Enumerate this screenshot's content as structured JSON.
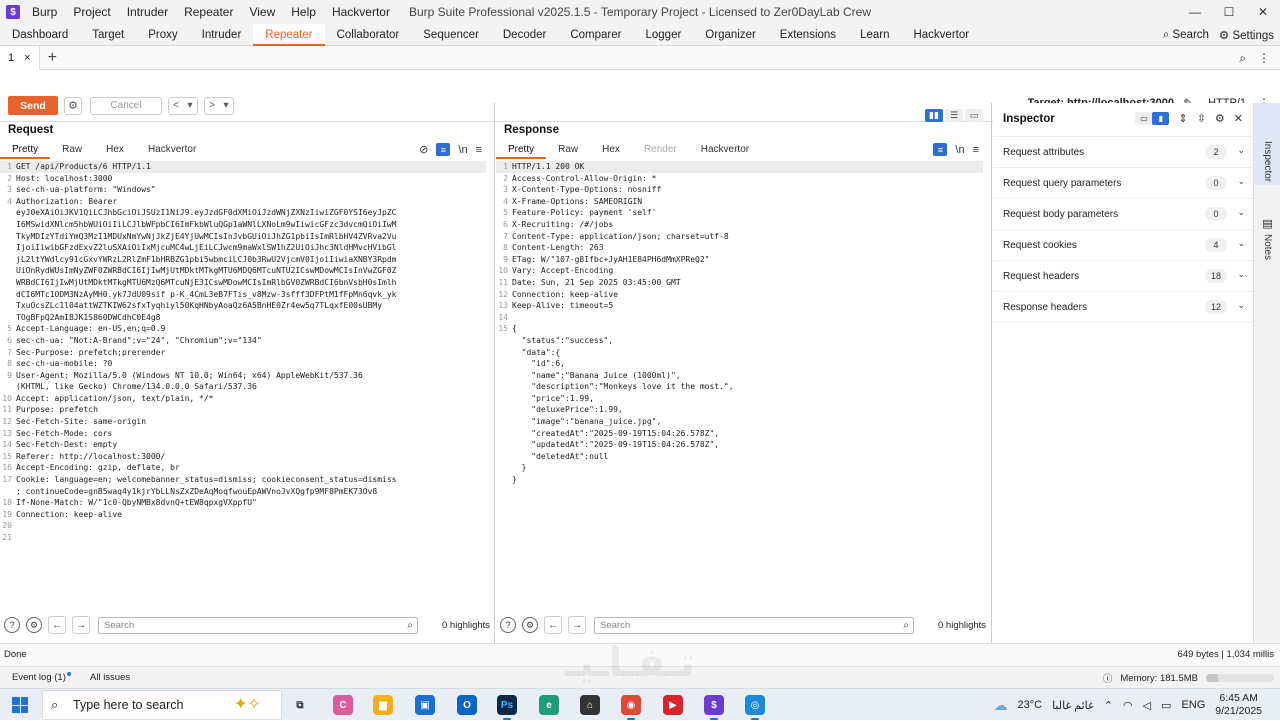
{
  "app": {
    "icon_letter": "$",
    "menu": [
      "Burp",
      "Project",
      "Intruder",
      "Repeater",
      "View",
      "Help",
      "Hackvertor"
    ],
    "title": "Burp Suite Professional v2025.1.5 - Temporary Project - Licensed to Zer0DayLab Crew",
    "window_controls": [
      "—",
      "☐",
      "✕"
    ]
  },
  "main_tabs": {
    "items": [
      "Dashboard",
      "Target",
      "Proxy",
      "Intruder",
      "Repeater",
      "Collaborator",
      "Sequencer",
      "Decoder",
      "Comparer",
      "Logger",
      "Organizer",
      "Extensions",
      "Learn",
      "Hackvertor"
    ],
    "active": "Repeater",
    "search_label": "Search",
    "settings_label": "Settings"
  },
  "repeater_tabs": {
    "tab_label": "1",
    "close": "×",
    "add": "+"
  },
  "toolbar": {
    "send_label": "Send",
    "cancel_label": "Cancel",
    "target_label": "Target: http://localhost:3000",
    "http_label": "HTTP/1"
  },
  "request": {
    "title": "Request",
    "view_tabs": [
      "Pretty",
      "Raw",
      "Hex",
      "Hackvertor"
    ],
    "active_view": "Pretty",
    "lines": [
      "GET /api/Products/6 HTTP/1.1",
      "Host: localhost:3000",
      "sec-ch-ua-platform: \"Windows\"",
      "Authorization: Bearer",
      "eyJ0eXAiOiJKV1QiLCJhbGciOiJSUzI1NiJ9.eyJzdGF0dXMiOiJzdWNjZXNzIiwiZGF0YSI6eyJpZC",
      "I6MSwidXNlcm5hbWUiOiIiLCJlbWFpbCI6ImFkbWluQGp1aWNlLXNoLm9wIiwicGFzc3dvcmQiOiIwM",
      "TkyMDIzYTdiYmQ3MzI1MDUxNmYwNjJkZjE4YjUwMCIsInJvbGUiOiJhZG1pbiIsImRlbHV4ZVRva2Vu",
      "IjoiIiwibGFzdExvZ2luSXAiOiIxMjcuMC4wLjEiLCJwcm9maWxlSW1hZ2UiOiJhc3NldHMvcHVibGl",
      "jL2ltYWdlcy91cGxvYWRzL2RlZmF1bHRBZG1pbi5wbmciLCJ0b3RwU2VjcmV0IjoiIiwiaXNBY3Rpdm",
      "UiOnRydWUsImNyZWF0ZWRBdCI6IjIwMjUtMDktMTkgMTU6MDQ6MTcuNTU2ICswMDowMCIsInVwZGF0Z",
      "WRBdCI6IjIwMjUtMDktMTkgMTU6MzQ6MTcuNjE3ICswMDowMCIsImRlbGV0ZWRBdCI6bnVsbH0sImlh",
      "dCI6MTc1ODM3NzAyMH0.yk7JdU09sif p-K_4CmL3eB7FTis_v8Mzw-3sfff3DFPtM1fFpMn6qvk_yk",
      "TxuOcsZLc1l04attWZTKIW62sfxTyqhiyl50KqHNbyAoaQz6A5BnHE0Zr4ew5q7TLqxfE00sUBMy",
      "TOgBFpQ2AmIBJK1S860DWCdhC0E4g8",
      "Accept-Language: en-US,en;q=0.9",
      "sec-ch-ua: \"Not:A-Brand\";v=\"24\", \"Chromium\";v=\"134\"",
      "Sec-Purpose: prefetch;prerender",
      "sec-ch-ua-mobile: ?0",
      "User-Agent: Mozilla/5.0 (Windows NT 10.0; Win64; x64) AppleWebKit/537.36",
      "(KHTML, like Gecko) Chrome/134.0.0.0 Safari/537.36",
      "Accept: application/json, text/plain, */*",
      "Purpose: prefetch",
      "Sec-Fetch-Site: same-origin",
      "Sec-Fetch-Mode: cors",
      "Sec-Fetch-Dest: empty",
      "Referer: http://localhost:3000/",
      "Accept-Encoding: gzip, deflate, br",
      "Cookie: language=en; welcomebanner_status=dismiss; cookieconsent_status=dismiss",
      "; continueCode=gnB5waq4y1kjrYbLLNsZxZDeAqMoqfwouEpAWVnoJvXQgfp9MF8PmEK73Ov8",
      "If-None-Match: W/\"1c0-QbyNMBx8dvnQ+tEW8qpxgVXppfU\"",
      "Connection: keep-alive",
      "",
      ""
    ],
    "line_numbers": [
      "1",
      "2",
      "3",
      "4",
      "",
      "",
      "",
      "",
      "",
      "",
      "",
      "",
      "",
      "",
      "5",
      "6",
      "7",
      "8",
      "9",
      "",
      "10",
      "11",
      "12",
      "13",
      "14",
      "15",
      "16",
      "17",
      "",
      "18",
      "19",
      "20",
      "21"
    ]
  },
  "response": {
    "title": "Response",
    "view_tabs": [
      "Pretty",
      "Raw",
      "Hex",
      "Render",
      "Hackvertor"
    ],
    "active_view": "Pretty",
    "lines": [
      "HTTP/1.1 200 OK",
      "Access-Control-Allow-Origin: *",
      "X-Content-Type-Options: nosniff",
      "X-Frame-Options: SAMEORIGIN",
      "Feature-Policy: payment 'self'",
      "X-Recruiting: /#/jobs",
      "Content-Type: application/json; charset=utf-8",
      "Content-Length: 263",
      "ETag: W/\"107-g8Ifbc+JyAH1E84PH6dMmXPReQ2\"",
      "Vary: Accept-Encoding",
      "Date: Sun, 21 Sep 2025 03:45:00 GMT",
      "Connection: keep-alive",
      "Keep-Alive: timeout=5",
      "",
      "{",
      "  \"status\":\"success\",",
      "  \"data\":{",
      "    \"id\":6,",
      "    \"name\":\"Banana Juice (1000ml)\",",
      "    \"description\":\"Monkeys love it the most.\",",
      "    \"price\":1.99,",
      "    \"deluxePrice\":1.99,",
      "    \"image\":\"banana_juice.jpg\",",
      "    \"createdAt\":\"2025-09-19T15:04:26.578Z\",",
      "    \"updatedAt\":\"2025-09-19T15:04:26.578Z\",",
      "    \"deletedAt\":null",
      "  }",
      "}"
    ],
    "line_numbers": [
      "1",
      "2",
      "3",
      "4",
      "5",
      "6",
      "7",
      "8",
      "9",
      "10",
      "11",
      "12",
      "13",
      "14",
      "15",
      "",
      "",
      "",
      "",
      "",
      "",
      "",
      "",
      "",
      "",
      "",
      "",
      ""
    ]
  },
  "search": {
    "placeholder": "Search",
    "highlights": "0 highlights"
  },
  "inspector": {
    "title": "Inspector",
    "rows": [
      {
        "label": "Request attributes",
        "count": "2"
      },
      {
        "label": "Request query parameters",
        "count": "0"
      },
      {
        "label": "Request body parameters",
        "count": "0"
      },
      {
        "label": "Request cookies",
        "count": "4"
      },
      {
        "label": "Request headers",
        "count": "18"
      },
      {
        "label": "Response headers",
        "count": "12"
      }
    ]
  },
  "side_tabs": [
    "Inspector",
    "Notes"
  ],
  "status": {
    "left": "Done",
    "right": "649 bytes | 1,034 millis"
  },
  "eventbar": {
    "event_log": "Event log (1)",
    "all_issues": "All issues",
    "memory": "Memory: 181.5MB",
    "memory_fraction": 0.18
  },
  "taskbar": {
    "search_placeholder": "Type here to search",
    "weather": "23°C",
    "weather_desc": "غائم غالبا",
    "lang": "ENG",
    "time": "6:45 AM",
    "date": "9/21/2025"
  },
  "colors": {
    "accent": "#e8622c",
    "highlight_blue": "#2d6fd2"
  }
}
